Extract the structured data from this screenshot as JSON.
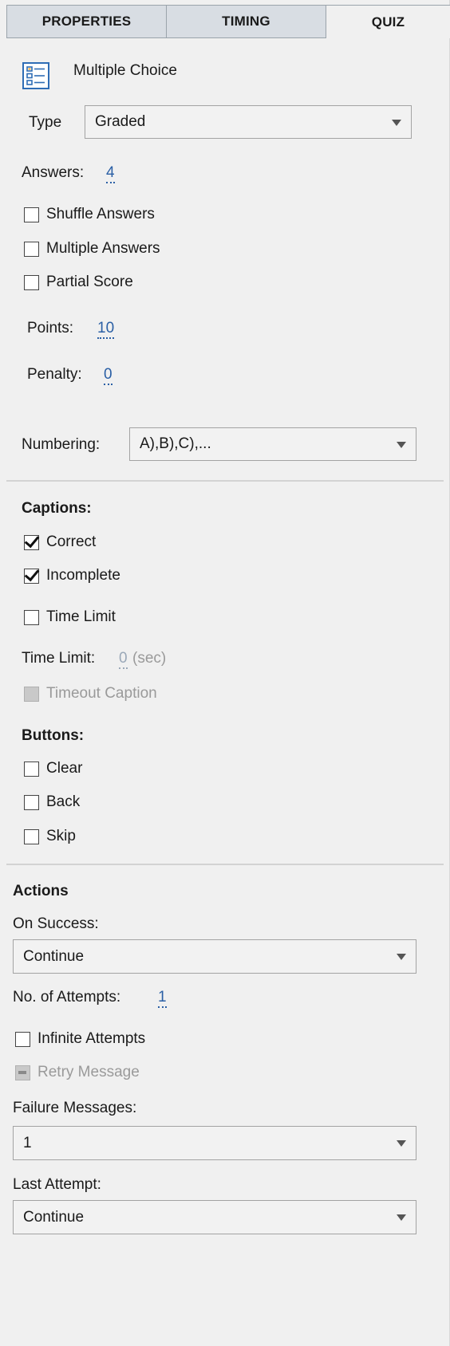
{
  "tabs": [
    {
      "label": "PROPERTIES"
    },
    {
      "label": "TIMING"
    },
    {
      "label": "QUIZ"
    }
  ],
  "question": {
    "icon": "multiple-choice-icon",
    "title": "Multiple Choice",
    "type_label": "Type",
    "type_value": "Graded",
    "answers_label": "Answers:",
    "answers_value": "4",
    "shuffle_label": "Shuffle Answers",
    "shuffle_checked": false,
    "multiple_label": "Multiple Answers",
    "multiple_checked": false,
    "partial_label": "Partial Score",
    "partial_checked": false,
    "points_label": "Points:",
    "points_value": "10",
    "penalty_label": "Penalty:",
    "penalty_value": "0",
    "numbering_label": "Numbering:",
    "numbering_value": "A),B),C),..."
  },
  "captions": {
    "heading": "Captions:",
    "correct_label": "Correct",
    "correct_checked": true,
    "incomplete_label": "Incomplete",
    "incomplete_checked": true,
    "time_limit_cb_label": "Time Limit",
    "time_limit_checked": false,
    "time_limit_label": "Time Limit:",
    "time_limit_value": "0",
    "time_limit_unit": "(sec)",
    "timeout_label": "Timeout Caption"
  },
  "buttons": {
    "heading": "Buttons:",
    "clear_label": "Clear",
    "back_label": "Back",
    "skip_label": "Skip"
  },
  "actions": {
    "heading": "Actions",
    "on_success_label": "On Success:",
    "on_success_value": "Continue",
    "attempts_label": "No. of Attempts:",
    "attempts_value": "1",
    "infinite_label": "Infinite Attempts",
    "retry_label": "Retry Message",
    "failure_label": "Failure Messages:",
    "failure_value": "1",
    "last_attempt_label": "Last Attempt:",
    "last_attempt_value": "Continue"
  },
  "colors": {
    "link": "#2a5fa5",
    "panel_bg": "#f0f0f0",
    "tab_bg": "#d8dde3"
  }
}
